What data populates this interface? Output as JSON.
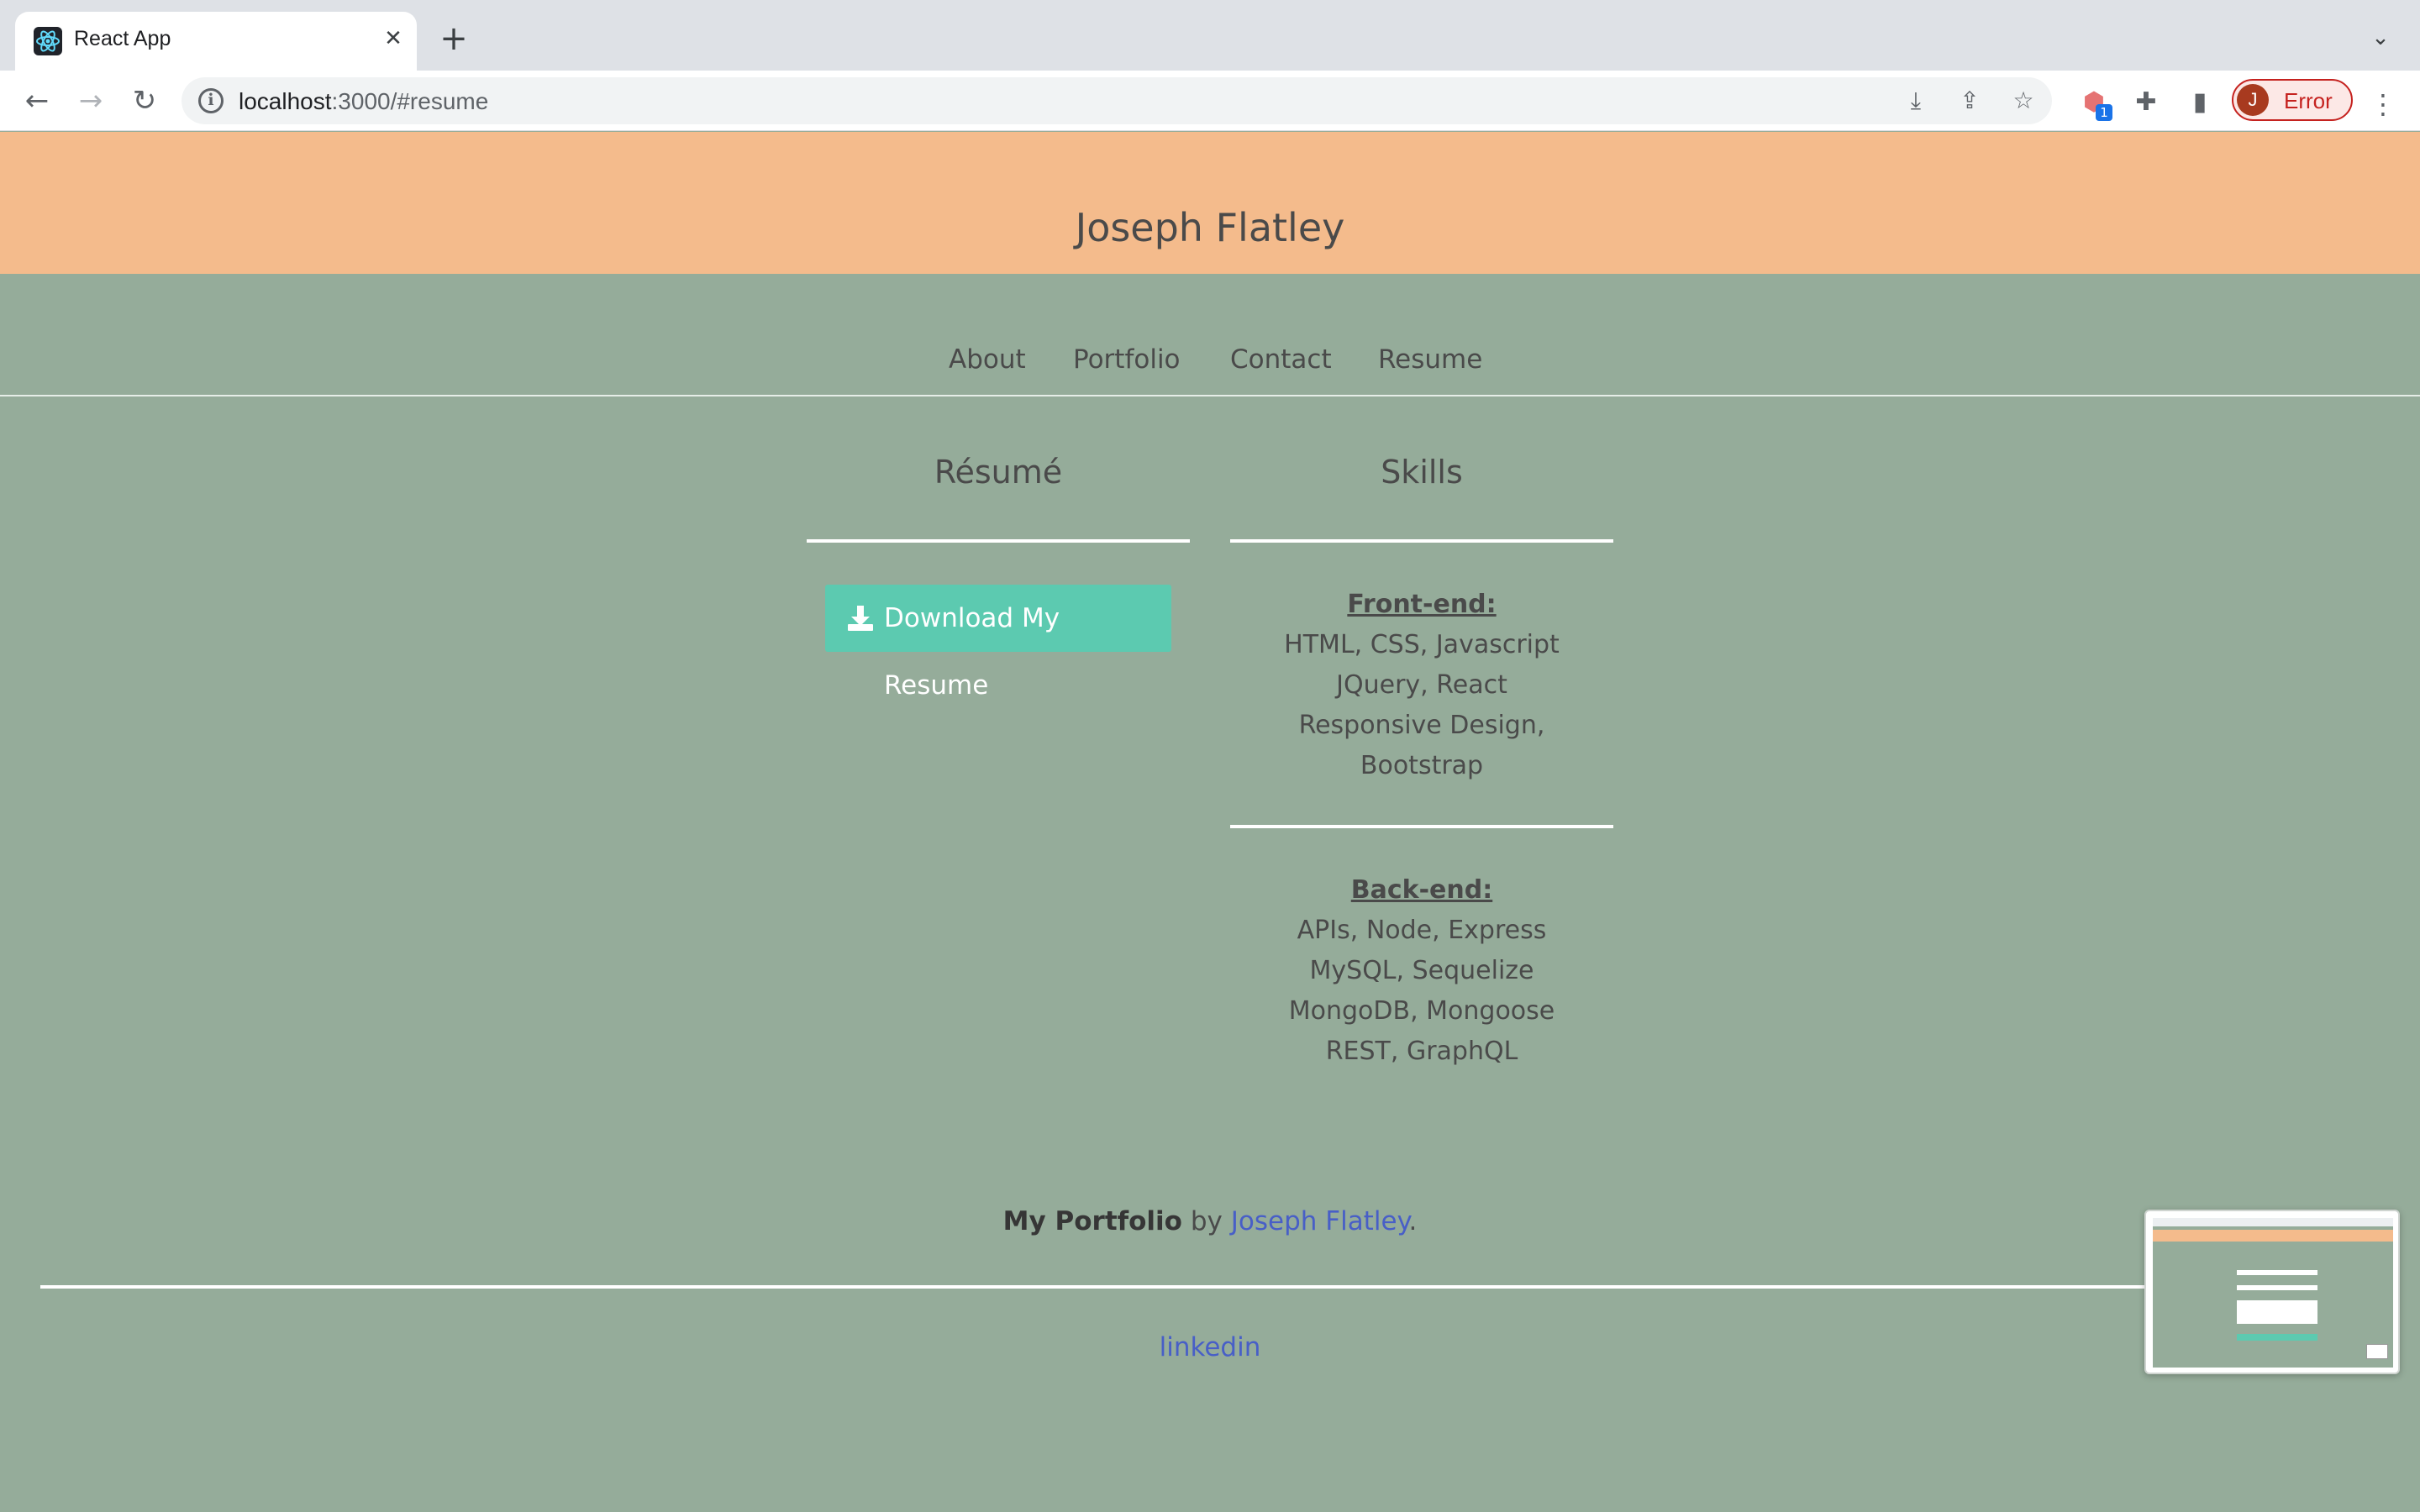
{
  "browser": {
    "tab_title": "React App",
    "tab_close": "✕",
    "new_tab": "+",
    "url_host": "localhost",
    "url_path": ":3000/#resume",
    "profile_initial": "J",
    "profile_status": "Error",
    "extension_badge": "1"
  },
  "header": {
    "title": "Joseph Flatley"
  },
  "nav": {
    "items": [
      "About",
      "Portfolio",
      "Contact",
      "Resume"
    ]
  },
  "resume": {
    "title": "Résumé",
    "download_label": "Download My Resume"
  },
  "skills": {
    "title": "Skills",
    "frontend_heading": "Front-end:",
    "frontend_items": [
      "HTML, CSS, Javascript",
      "JQuery, React",
      "Responsive Design,",
      "Bootstrap"
    ],
    "backend_heading": "Back-end:",
    "backend_items": [
      "APIs, Node, Express",
      "MySQL, Sequelize",
      "MongoDB, Mongoose",
      "REST, GraphQL"
    ]
  },
  "footer": {
    "brand": "My Portfolio",
    "by": "by",
    "author": "Joseph Flatley",
    "period": ".",
    "social_link": "linkedin"
  },
  "colors": {
    "header_bg": "#f4bb8c",
    "page_bg": "#95ac9a",
    "button_bg": "#5ccab0",
    "link": "#485fc7"
  }
}
